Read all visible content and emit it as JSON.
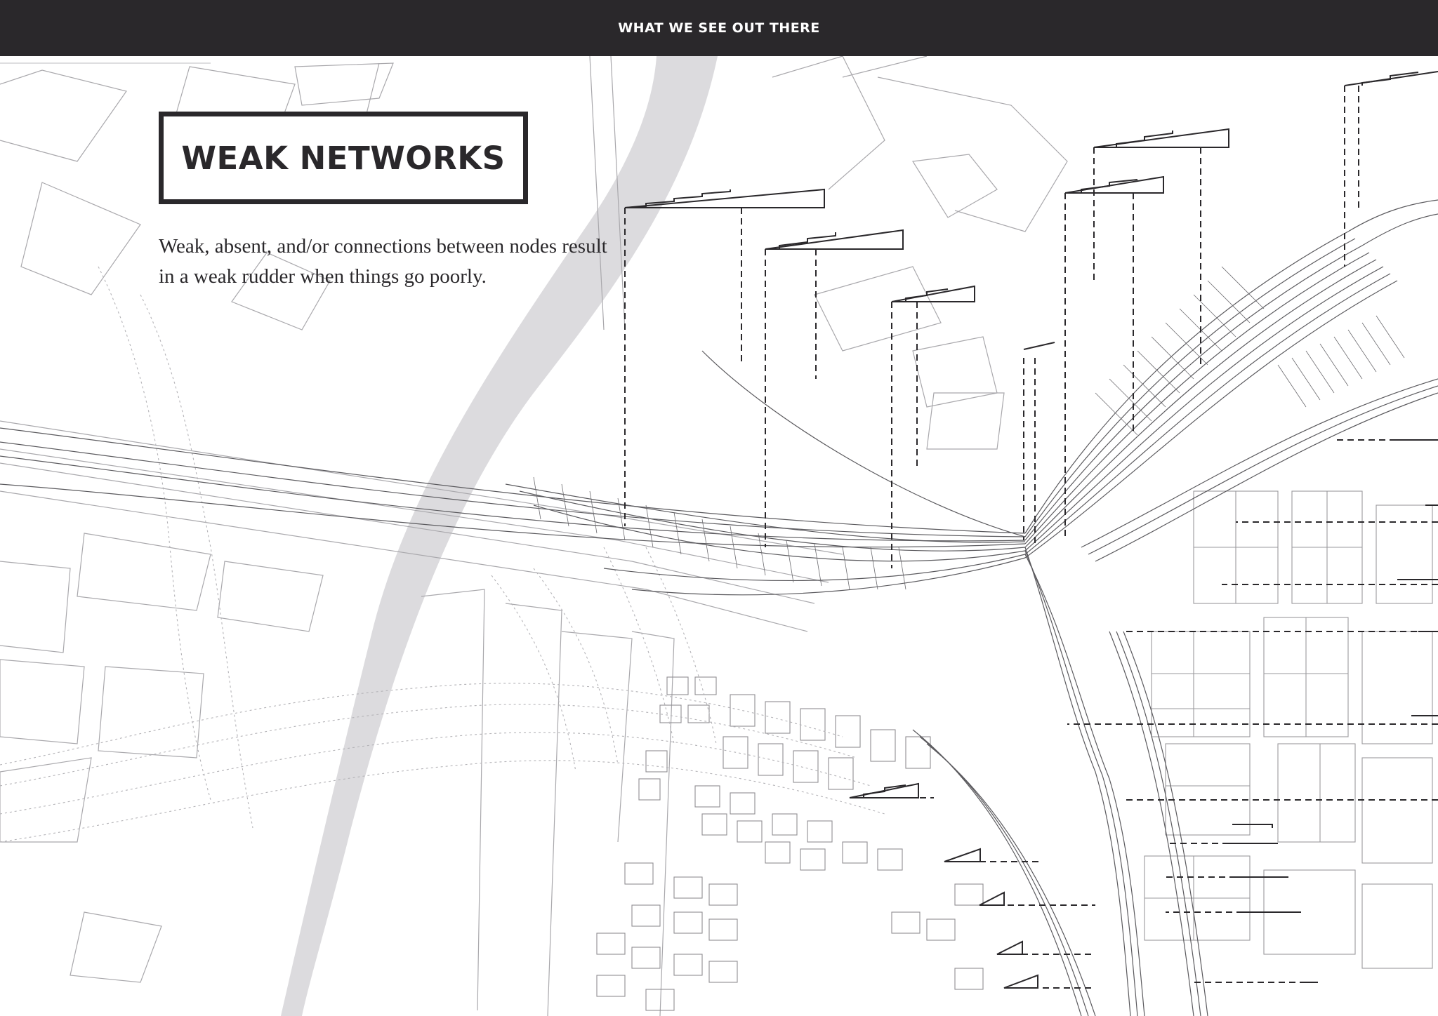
{
  "header": {
    "title": "WHAT WE SEE OUT THERE"
  },
  "panel": {
    "title": "WEAK NETWORKS",
    "description": "Weak, absent, and/or connections between nodes result in a weak rudder when things go poorly."
  },
  "colors": {
    "bar": "#2a282b",
    "river": "#d2d1d4",
    "line": "#7a787c",
    "ink": "#2a282b",
    "background": "#ffffff"
  }
}
